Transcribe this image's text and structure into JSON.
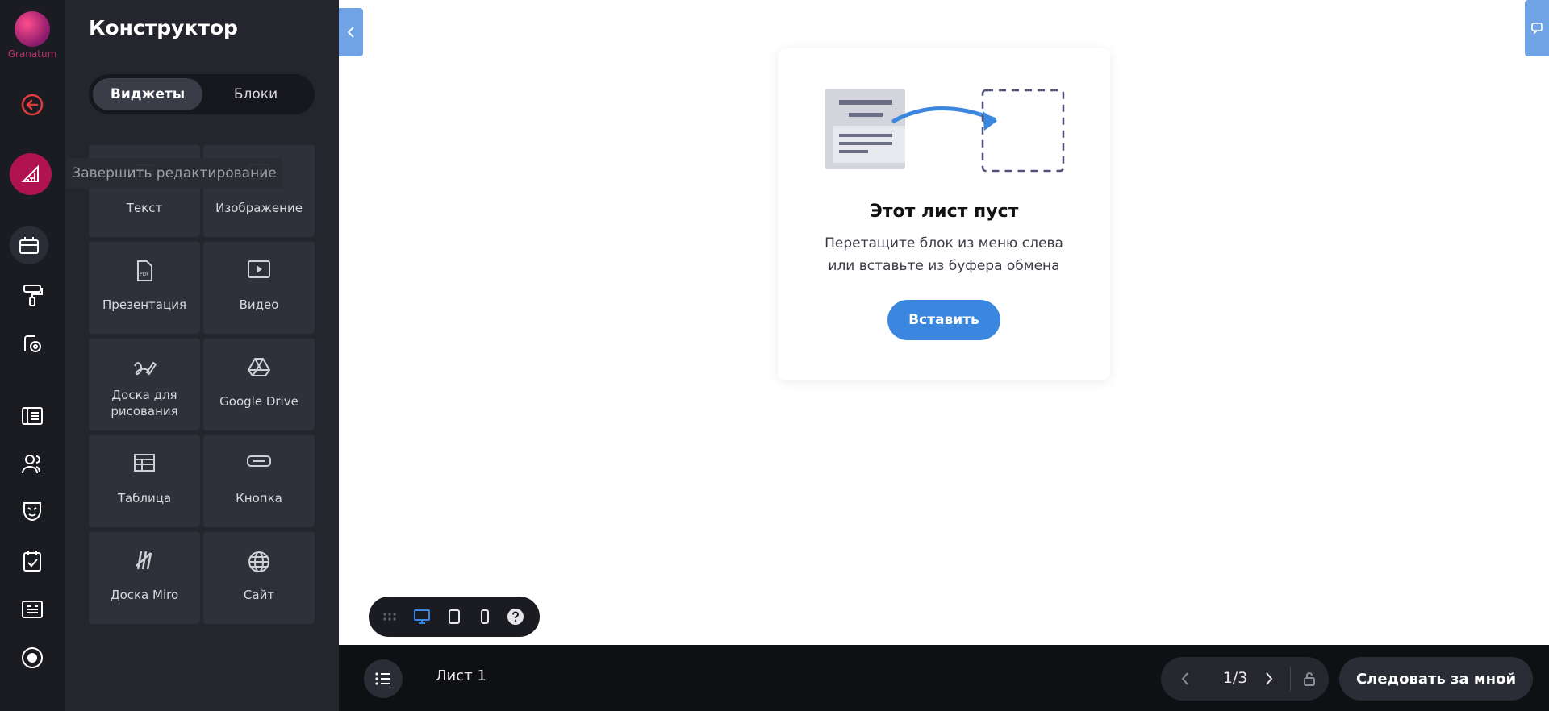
{
  "logo": {
    "text": "Granatum"
  },
  "rail": {
    "items": [
      "back-icon",
      "design-icon",
      "widgets-icon",
      "paint-roller-icon",
      "settings-icon",
      "list-layout-icon",
      "users-icon",
      "masks-icon",
      "checklist-icon",
      "form-icon",
      "record-icon"
    ]
  },
  "tooltip": {
    "text": "Завершить редактирование"
  },
  "panel": {
    "title": "Конструктор",
    "tabs": {
      "widgets": "Виджеты",
      "blocks": "Блоки"
    },
    "tiles": [
      {
        "label": "Текст",
        "icon": "text-icon"
      },
      {
        "label": "Изображение",
        "icon": "image-icon"
      },
      {
        "label": "Презентация",
        "icon": "pdf-icon"
      },
      {
        "label": "Видео",
        "icon": "video-icon"
      },
      {
        "label": "Доска для рисования",
        "icon": "draw-icon"
      },
      {
        "label": "Google Drive",
        "icon": "google-drive-icon"
      },
      {
        "label": "Таблица",
        "icon": "table-icon"
      },
      {
        "label": "Кнопка",
        "icon": "button-icon"
      },
      {
        "label": "Доска Miro",
        "icon": "miro-icon"
      },
      {
        "label": "Сайт",
        "icon": "globe-icon"
      }
    ]
  },
  "empty": {
    "title": "Этот лист пуст",
    "line1": "Перетащите блок из меню слева",
    "line2": "или вставьте из буфера обмена",
    "button": "Вставить"
  },
  "bottom": {
    "sheet": "Лист 1",
    "page": "1/3",
    "follow": "Следовать за мной"
  },
  "colors": {
    "accent": "#3b87e0",
    "active": "#b0134f",
    "danger": "#e23b3b"
  }
}
